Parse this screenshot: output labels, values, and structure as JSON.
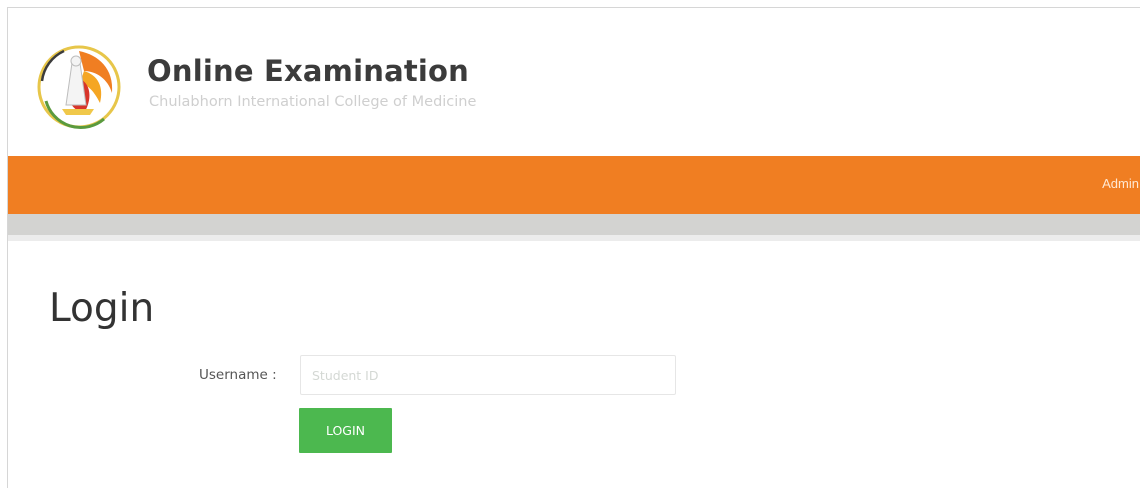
{
  "header": {
    "title": "Online Examination",
    "subtitle": "Chulabhorn International College of Medicine",
    "logo_icon": "college-seal-logo"
  },
  "navbar": {
    "admin_label": "Admin",
    "color": "#f07e22"
  },
  "login": {
    "heading": "Login",
    "username_label": "Username :",
    "username_placeholder": "Student ID",
    "username_value": "",
    "button_label": "LOGIN",
    "button_color": "#4cb84f"
  }
}
